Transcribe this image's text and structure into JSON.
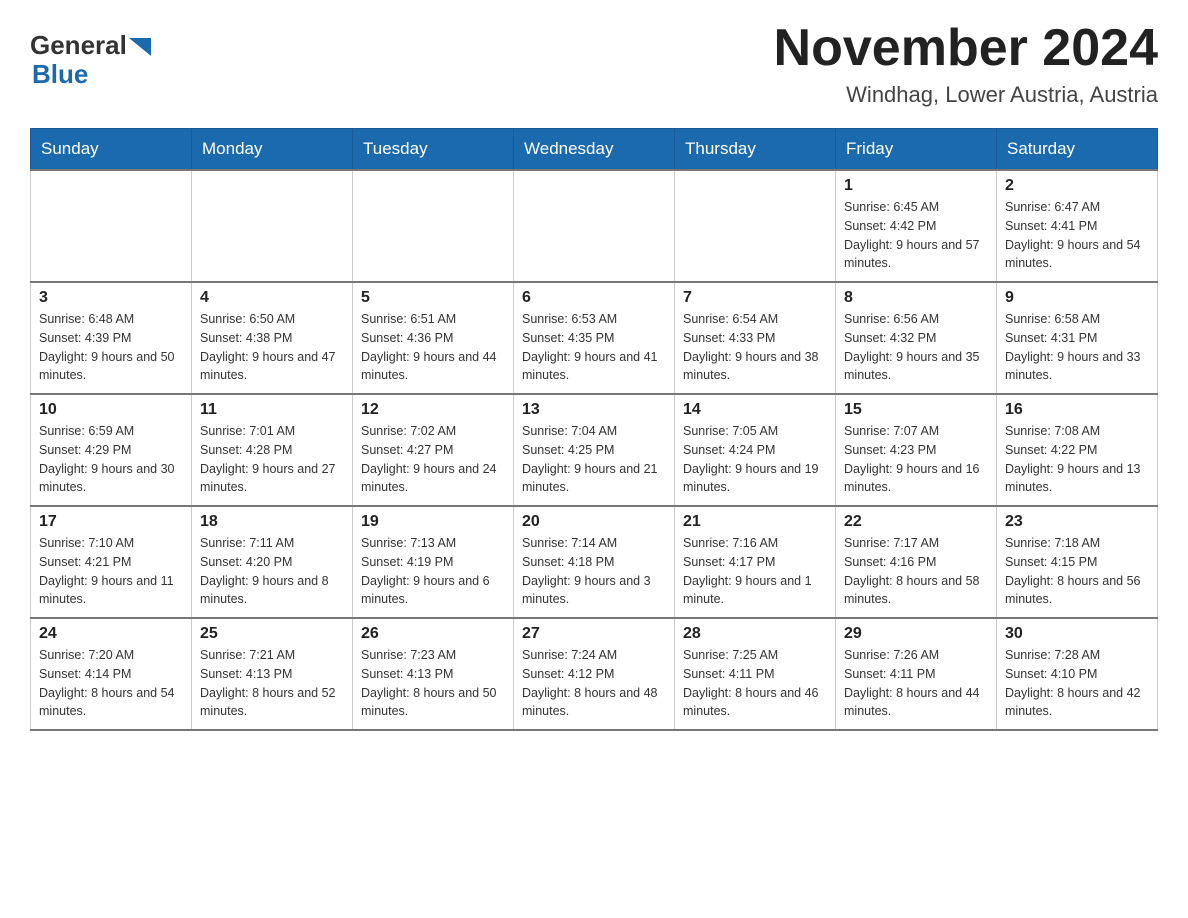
{
  "header": {
    "logo": {
      "general": "General",
      "blue": "Blue",
      "triangle": "▶"
    },
    "title": "November 2024",
    "location": "Windhag, Lower Austria, Austria"
  },
  "weekdays": [
    "Sunday",
    "Monday",
    "Tuesday",
    "Wednesday",
    "Thursday",
    "Friday",
    "Saturday"
  ],
  "weeks": [
    [
      {
        "day": "",
        "sunrise": "",
        "sunset": "",
        "daylight": ""
      },
      {
        "day": "",
        "sunrise": "",
        "sunset": "",
        "daylight": ""
      },
      {
        "day": "",
        "sunrise": "",
        "sunset": "",
        "daylight": ""
      },
      {
        "day": "",
        "sunrise": "",
        "sunset": "",
        "daylight": ""
      },
      {
        "day": "",
        "sunrise": "",
        "sunset": "",
        "daylight": ""
      },
      {
        "day": "1",
        "sunrise": "Sunrise: 6:45 AM",
        "sunset": "Sunset: 4:42 PM",
        "daylight": "Daylight: 9 hours and 57 minutes."
      },
      {
        "day": "2",
        "sunrise": "Sunrise: 6:47 AM",
        "sunset": "Sunset: 4:41 PM",
        "daylight": "Daylight: 9 hours and 54 minutes."
      }
    ],
    [
      {
        "day": "3",
        "sunrise": "Sunrise: 6:48 AM",
        "sunset": "Sunset: 4:39 PM",
        "daylight": "Daylight: 9 hours and 50 minutes."
      },
      {
        "day": "4",
        "sunrise": "Sunrise: 6:50 AM",
        "sunset": "Sunset: 4:38 PM",
        "daylight": "Daylight: 9 hours and 47 minutes."
      },
      {
        "day": "5",
        "sunrise": "Sunrise: 6:51 AM",
        "sunset": "Sunset: 4:36 PM",
        "daylight": "Daylight: 9 hours and 44 minutes."
      },
      {
        "day": "6",
        "sunrise": "Sunrise: 6:53 AM",
        "sunset": "Sunset: 4:35 PM",
        "daylight": "Daylight: 9 hours and 41 minutes."
      },
      {
        "day": "7",
        "sunrise": "Sunrise: 6:54 AM",
        "sunset": "Sunset: 4:33 PM",
        "daylight": "Daylight: 9 hours and 38 minutes."
      },
      {
        "day": "8",
        "sunrise": "Sunrise: 6:56 AM",
        "sunset": "Sunset: 4:32 PM",
        "daylight": "Daylight: 9 hours and 35 minutes."
      },
      {
        "day": "9",
        "sunrise": "Sunrise: 6:58 AM",
        "sunset": "Sunset: 4:31 PM",
        "daylight": "Daylight: 9 hours and 33 minutes."
      }
    ],
    [
      {
        "day": "10",
        "sunrise": "Sunrise: 6:59 AM",
        "sunset": "Sunset: 4:29 PM",
        "daylight": "Daylight: 9 hours and 30 minutes."
      },
      {
        "day": "11",
        "sunrise": "Sunrise: 7:01 AM",
        "sunset": "Sunset: 4:28 PM",
        "daylight": "Daylight: 9 hours and 27 minutes."
      },
      {
        "day": "12",
        "sunrise": "Sunrise: 7:02 AM",
        "sunset": "Sunset: 4:27 PM",
        "daylight": "Daylight: 9 hours and 24 minutes."
      },
      {
        "day": "13",
        "sunrise": "Sunrise: 7:04 AM",
        "sunset": "Sunset: 4:25 PM",
        "daylight": "Daylight: 9 hours and 21 minutes."
      },
      {
        "day": "14",
        "sunrise": "Sunrise: 7:05 AM",
        "sunset": "Sunset: 4:24 PM",
        "daylight": "Daylight: 9 hours and 19 minutes."
      },
      {
        "day": "15",
        "sunrise": "Sunrise: 7:07 AM",
        "sunset": "Sunset: 4:23 PM",
        "daylight": "Daylight: 9 hours and 16 minutes."
      },
      {
        "day": "16",
        "sunrise": "Sunrise: 7:08 AM",
        "sunset": "Sunset: 4:22 PM",
        "daylight": "Daylight: 9 hours and 13 minutes."
      }
    ],
    [
      {
        "day": "17",
        "sunrise": "Sunrise: 7:10 AM",
        "sunset": "Sunset: 4:21 PM",
        "daylight": "Daylight: 9 hours and 11 minutes."
      },
      {
        "day": "18",
        "sunrise": "Sunrise: 7:11 AM",
        "sunset": "Sunset: 4:20 PM",
        "daylight": "Daylight: 9 hours and 8 minutes."
      },
      {
        "day": "19",
        "sunrise": "Sunrise: 7:13 AM",
        "sunset": "Sunset: 4:19 PM",
        "daylight": "Daylight: 9 hours and 6 minutes."
      },
      {
        "day": "20",
        "sunrise": "Sunrise: 7:14 AM",
        "sunset": "Sunset: 4:18 PM",
        "daylight": "Daylight: 9 hours and 3 minutes."
      },
      {
        "day": "21",
        "sunrise": "Sunrise: 7:16 AM",
        "sunset": "Sunset: 4:17 PM",
        "daylight": "Daylight: 9 hours and 1 minute."
      },
      {
        "day": "22",
        "sunrise": "Sunrise: 7:17 AM",
        "sunset": "Sunset: 4:16 PM",
        "daylight": "Daylight: 8 hours and 58 minutes."
      },
      {
        "day": "23",
        "sunrise": "Sunrise: 7:18 AM",
        "sunset": "Sunset: 4:15 PM",
        "daylight": "Daylight: 8 hours and 56 minutes."
      }
    ],
    [
      {
        "day": "24",
        "sunrise": "Sunrise: 7:20 AM",
        "sunset": "Sunset: 4:14 PM",
        "daylight": "Daylight: 8 hours and 54 minutes."
      },
      {
        "day": "25",
        "sunrise": "Sunrise: 7:21 AM",
        "sunset": "Sunset: 4:13 PM",
        "daylight": "Daylight: 8 hours and 52 minutes."
      },
      {
        "day": "26",
        "sunrise": "Sunrise: 7:23 AM",
        "sunset": "Sunset: 4:13 PM",
        "daylight": "Daylight: 8 hours and 50 minutes."
      },
      {
        "day": "27",
        "sunrise": "Sunrise: 7:24 AM",
        "sunset": "Sunset: 4:12 PM",
        "daylight": "Daylight: 8 hours and 48 minutes."
      },
      {
        "day": "28",
        "sunrise": "Sunrise: 7:25 AM",
        "sunset": "Sunset: 4:11 PM",
        "daylight": "Daylight: 8 hours and 46 minutes."
      },
      {
        "day": "29",
        "sunrise": "Sunrise: 7:26 AM",
        "sunset": "Sunset: 4:11 PM",
        "daylight": "Daylight: 8 hours and 44 minutes."
      },
      {
        "day": "30",
        "sunrise": "Sunrise: 7:28 AM",
        "sunset": "Sunset: 4:10 PM",
        "daylight": "Daylight: 8 hours and 42 minutes."
      }
    ]
  ]
}
